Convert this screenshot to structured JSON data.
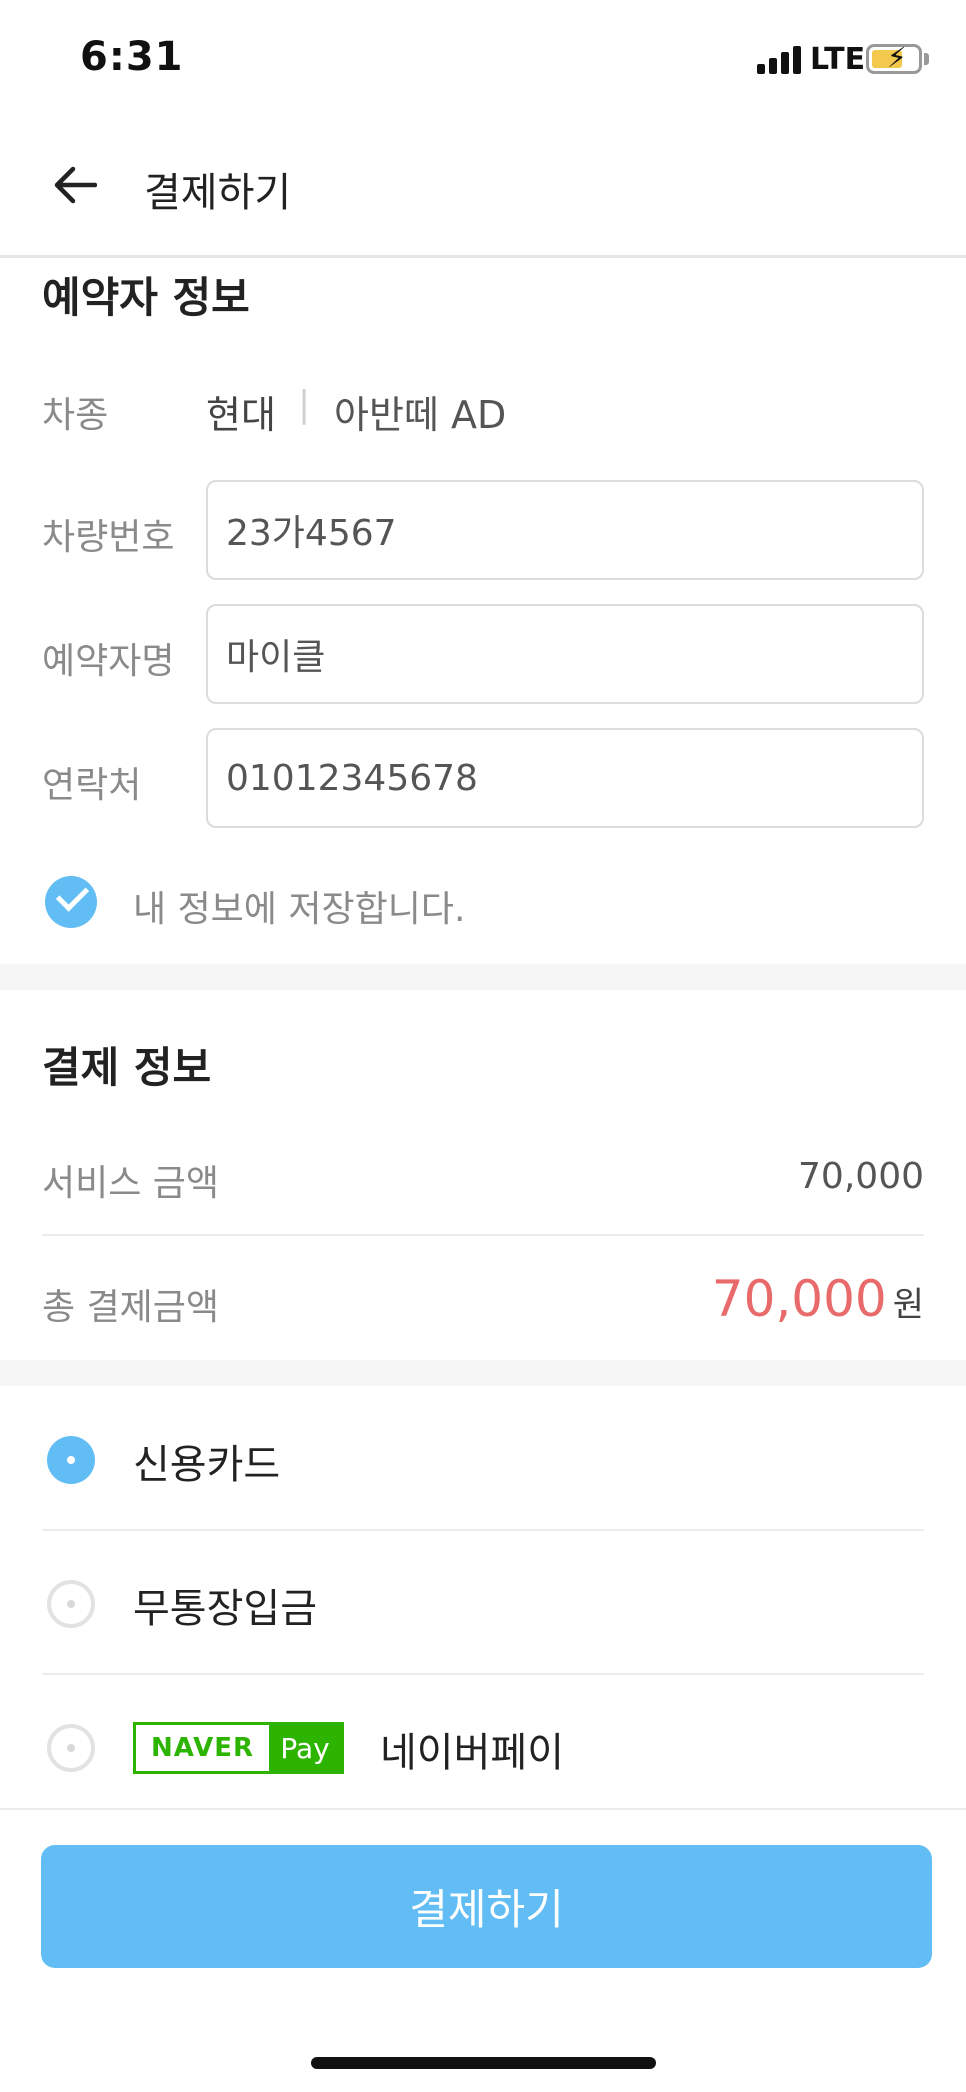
{
  "status_bar": {
    "time": "6:31",
    "network": "LTE",
    "battery_state": "charging"
  },
  "header": {
    "title": "결제하기",
    "back_icon": "arrow-left-icon"
  },
  "reservation": {
    "section_title": "예약자 정보",
    "car_type_label": "차종",
    "car_brand": "현대",
    "car_separator": "|",
    "car_model": "아반떼 AD",
    "plate_label": "차량번호",
    "plate_value": "23가4567",
    "name_label": "예약자명",
    "name_value": "마이클",
    "contact_label": "연락처",
    "contact_value": "01012345678",
    "save_checked": true,
    "save_label": "내 정보에 저장합니다."
  },
  "payment_info": {
    "section_title": "결제 정보",
    "service_label": "서비스 금액",
    "service_amount": "70,000",
    "total_label": "총 결제금액",
    "total_amount": "70,000",
    "total_unit": "원"
  },
  "payment_methods": [
    {
      "label": "신용카드",
      "selected": true
    },
    {
      "label": "무통장입금",
      "selected": false
    },
    {
      "label": "네이버페이",
      "selected": false,
      "logo_naver": "NAVER",
      "logo_pay": "Pay"
    }
  ],
  "pay_button": {
    "label": "결제하기"
  },
  "colors": {
    "accent": "#62bdf4",
    "price_red": "#e86a6a",
    "naver_green": "#2db400"
  }
}
